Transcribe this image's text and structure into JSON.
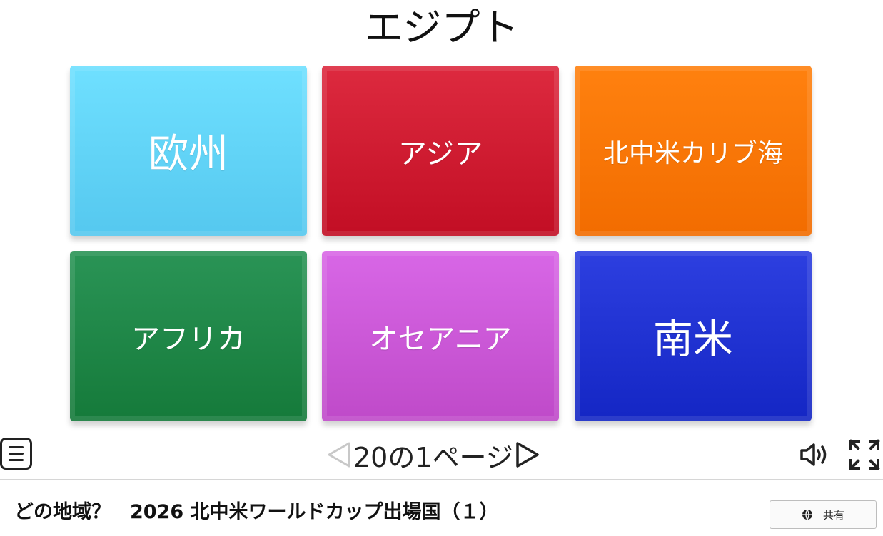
{
  "question": "エジプト",
  "options": [
    {
      "label": "欧州",
      "color": "#5fd6fb"
    },
    {
      "label": "アジア",
      "color": "#d01b31"
    },
    {
      "label": "北中米カリブ海",
      "color": "#fb7a08"
    },
    {
      "label": "アフリカ",
      "color": "#1f8849"
    },
    {
      "label": "オセアニア",
      "color": "#cd5cd9"
    },
    {
      "label": "南米",
      "color": "#2133d4"
    }
  ],
  "pagination": {
    "text": "20の1ページ",
    "prev_icon": "triangle-left-icon",
    "next_icon": "triangle-right-icon"
  },
  "controls": {
    "menu_icon": "hamburger-menu-icon",
    "sound_icon": "speaker-icon",
    "fullscreen_icon": "fullscreen-icon"
  },
  "footer": {
    "title": "どの地域？　2026 北中米ワールドカップ出場国（１）",
    "share_label": "共有",
    "share_icon": "globe-icon"
  }
}
